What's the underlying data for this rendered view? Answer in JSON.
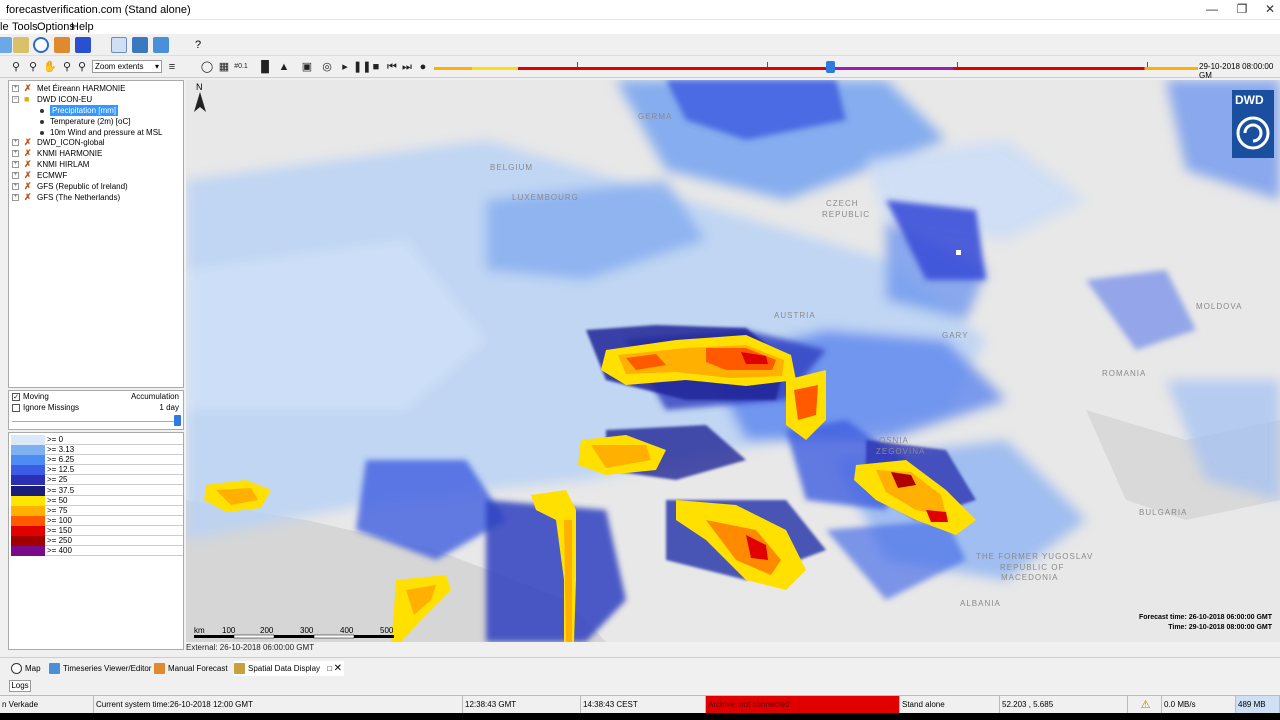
{
  "window": {
    "title": "forecastverification.com  (Stand alone)"
  },
  "menu": [
    "le",
    "Tools",
    "Options",
    "Help"
  ],
  "toolbar2": {
    "zoom_select": "Zoom extents",
    "timeline_label": "29-10-2018 08:00:00 GM",
    "help": "?"
  },
  "tree": [
    {
      "label": "Met Éireann HARMONIE",
      "level": 0
    },
    {
      "label": "DWD ICON-EU",
      "level": 0,
      "open": true
    },
    {
      "label": "Precipitation [mm]",
      "level": 1,
      "selected": true
    },
    {
      "label": "Temperature (2m) [oC]",
      "level": 1
    },
    {
      "label": "10m Wind and pressure at MSL",
      "level": 1
    },
    {
      "label": "DWD_ICON-global",
      "level": 0
    },
    {
      "label": "KNMI HARMONIE",
      "level": 0
    },
    {
      "label": "KNMI HIRLAM",
      "level": 0
    },
    {
      "label": "ECMWF",
      "level": 0
    },
    {
      "label": "GFS (Republic of Ireland)",
      "level": 0
    },
    {
      "label": "GFS (The Netherlands)",
      "level": 0
    }
  ],
  "options": {
    "moving": "Moving",
    "ignore_missings": "Ignore Missings",
    "accumulation": "Accumulation",
    "accumulation_value": "1 day"
  },
  "legend": [
    {
      "label": ">= 0",
      "color": "#dbe8f7"
    },
    {
      "label": ">= 3.13",
      "color": "#7fb0f0"
    },
    {
      "label": ">= 6.25",
      "color": "#4d8cf5"
    },
    {
      "label": ">= 12.5",
      "color": "#3d5ce6"
    },
    {
      "label": ">= 25",
      "color": "#2a2fb3"
    },
    {
      "label": ">= 37.5",
      "color": "#1c1c7a"
    },
    {
      "label": ">= 50",
      "color": "#ffe600"
    },
    {
      "label": ">= 75",
      "color": "#ffb000"
    },
    {
      "label": ">= 100",
      "color": "#ff5a00"
    },
    {
      "label": ">= 150",
      "color": "#e00000"
    },
    {
      "label": ">= 250",
      "color": "#a00000"
    },
    {
      "label": ">= 400",
      "color": "#7a0a8a"
    }
  ],
  "map": {
    "countries": [
      "GERMA",
      "BELGIUM",
      "LUXEMBOURG",
      "CZECH",
      "REPUBLIC",
      "AUSTRIA",
      "GARY",
      "MOLDOVA",
      "ROMANIA",
      "BULGARIA",
      "THE FORMER YUGOSLAV",
      "REPUBLIC OF",
      "MACEDONIA",
      "ALBANIA",
      "OSNIA",
      "ZEGOVINA"
    ],
    "logo": "DWD",
    "north": "N",
    "scale_unit": "km",
    "scale_ticks": [
      "100",
      "200",
      "300",
      "400",
      "500"
    ],
    "forecast_time": "Forecast time: 26-10-2018 06:00:00 GMT",
    "time": "Time: 29-10-2018 08:00:00 GMT"
  },
  "external_label": "External: 26-10-2018 06:00:00 GMT",
  "bottom_tabs": [
    "Map",
    "Timeseries Viewer/Editor",
    "Manual Forecast",
    "Spatial Data Display"
  ],
  "logs_button": "Logs",
  "status": {
    "user": "n Verkade",
    "system_time": "Current system time:26-10-2018 12:00 GMT",
    "gmt": "12:38:43 GMT",
    "cest": "14:38:43 CEST",
    "archive": "Archive: not connected",
    "mode": "Stand alone",
    "coords": "52.203 , 5.685",
    "rate": "0.0 MB/s",
    "mem": "489 MB"
  },
  "colors": {
    "archive_bg": "#e00000",
    "selection": "#3399ff"
  }
}
